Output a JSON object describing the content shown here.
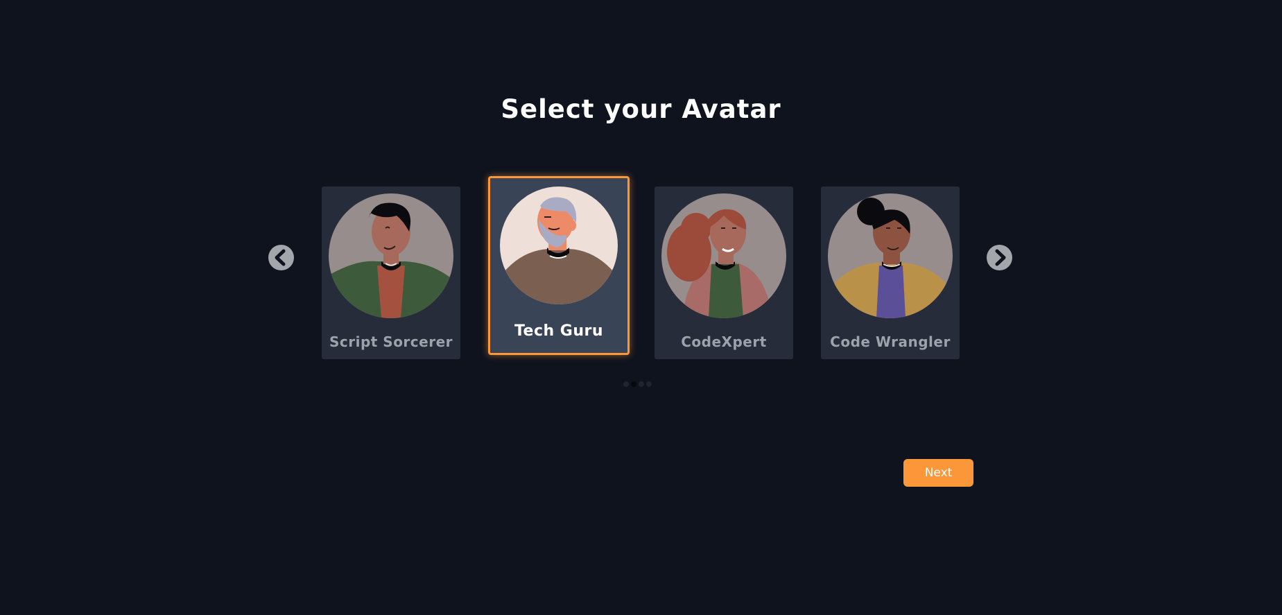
{
  "page": {
    "title": "Select your Avatar"
  },
  "carousel": {
    "prev_icon": "chevron-left-icon",
    "next_icon": "chevron-right-icon",
    "cards": [
      {
        "name": "Script Sorcerer",
        "selected": false,
        "skin": "#a6695b",
        "hair": "#0b0b0f",
        "shirt": "#a5513f",
        "jacket": "#3d5a3b",
        "bg": "#978d8d"
      },
      {
        "name": "Tech Guru",
        "selected": true,
        "skin": "#ed8a68",
        "hair": "#a9abc4",
        "shirt": "#7b5f51",
        "bg": "#efdfd9"
      },
      {
        "name": "CodeXpert",
        "selected": false,
        "skin": "#a6695b",
        "hair": "#9c4a39",
        "shirt": "#3d5a3b",
        "bg": "#978d8d"
      },
      {
        "name": "Code Wrangler",
        "selected": false,
        "skin": "#8d5340",
        "hair": "#0b0b0f",
        "shirt": "#5b4f98",
        "jacket": "#ba9149",
        "bg": "#978d8d"
      }
    ],
    "pagination": {
      "total": 4,
      "active_index": 1
    }
  },
  "footer": {
    "next_label": "Next"
  },
  "colors": {
    "background": "#0f131e",
    "accent": "#fb9639",
    "card": "#262c3a",
    "card_selected": "#3a4457"
  }
}
